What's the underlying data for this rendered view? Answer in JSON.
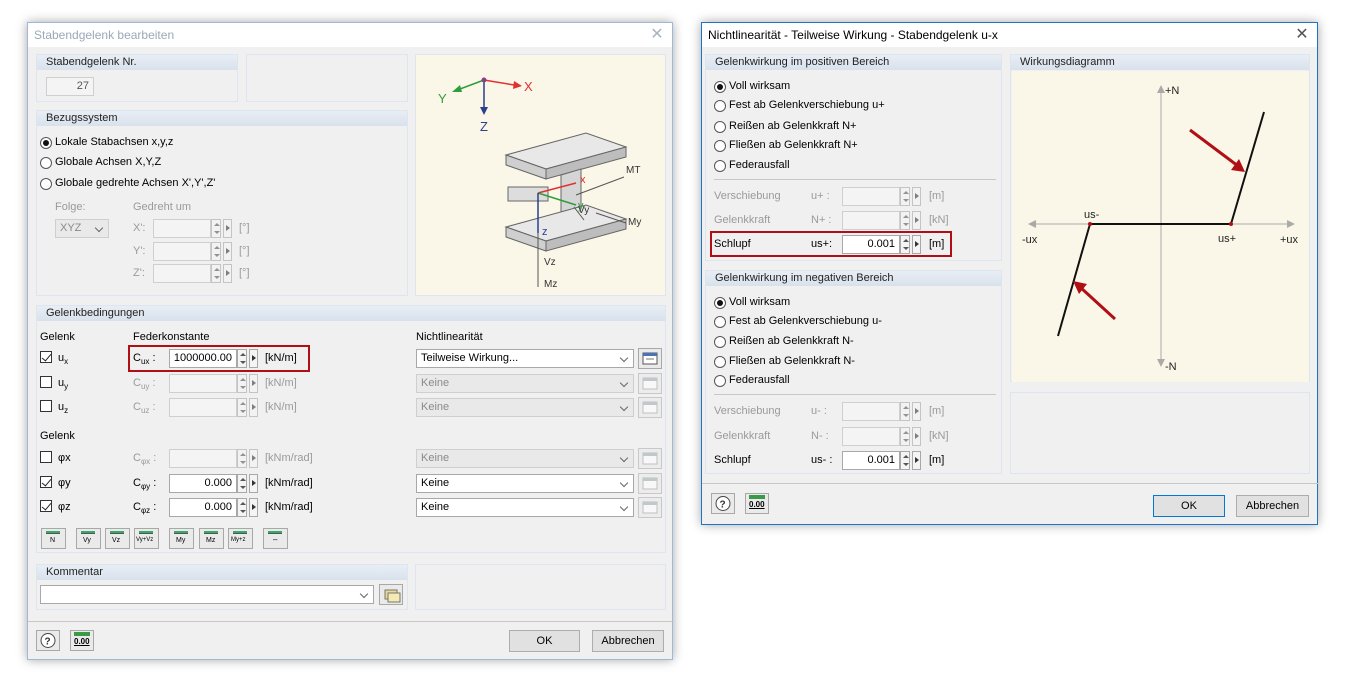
{
  "left_dialog": {
    "title": "Stabendgelenk bearbeiten",
    "nr_label": "Stabendgelenk Nr.",
    "nr_value": "27",
    "ref_label": "Bezugssystem",
    "ref_options": [
      "Lokale Stabachsen x,y,z",
      "Globale Achsen X,Y,Z",
      "Globale gedrehte Achsen X',Y',Z'"
    ],
    "folge_label": "Folge:",
    "folge_value": "XYZ",
    "gedreht_label": "Gedreht um",
    "rot_axes": [
      "X':",
      "Y':",
      "Z':"
    ],
    "deg_unit": "[°]",
    "cond_label": "Gelenkbedingungen",
    "gelenk_label": "Gelenk",
    "feder_label": "Federkonstante",
    "nonlin_label": "Nichtlinearität",
    "translations": [
      {
        "name": "ux",
        "sub": "x",
        "checked": true,
        "const_main": "C",
        "const_sub": "ux",
        "value": "1000000.00",
        "unit": "[kN/m]",
        "nonlin": "Teilweise Wirkung...",
        "enabled": true
      },
      {
        "name": "uy",
        "sub": "y",
        "checked": false,
        "const_main": "C",
        "const_sub": "uy",
        "value": "",
        "unit": "[kN/m]",
        "nonlin": "Keine",
        "enabled": false
      },
      {
        "name": "uz",
        "sub": "z",
        "checked": false,
        "const_main": "C",
        "const_sub": "uz",
        "value": "",
        "unit": "[kN/m]",
        "nonlin": "Keine",
        "enabled": false
      }
    ],
    "rotations": [
      {
        "name": "φx",
        "checked": false,
        "const_main": "C",
        "const_sub": "φx",
        "value": "",
        "unit": "[kNm/rad]",
        "nonlin": "Keine",
        "enabled": false
      },
      {
        "name": "φy",
        "checked": true,
        "const_main": "C",
        "const_sub": "φy",
        "value": "0.000",
        "unit": "[kNm/rad]",
        "nonlin": "Keine",
        "enabled": true
      },
      {
        "name": "φz",
        "checked": true,
        "const_main": "C",
        "const_sub": "φz",
        "value": "0.000",
        "unit": "[kNm/rad]",
        "nonlin": "Keine",
        "enabled": true
      }
    ],
    "preset_buttons": [
      "N",
      "Vy",
      "Vz",
      "Vy+Vz",
      "My",
      "Mz",
      "My+z",
      "–"
    ],
    "comment_label": "Kommentar",
    "ok_label": "OK",
    "cancel_label": "Abbrechen",
    "calc_label": "0.00",
    "graphic_labels": {
      "x": "X",
      "y": "Y",
      "z": "Z",
      "lx": "x",
      "ly": "y",
      "lz": "z",
      "mt": "MT",
      "my": "My",
      "vy": "Vy",
      "vz": "Vz",
      "mz": "Mz"
    }
  },
  "right_dialog": {
    "title": "Nichtlinearität - Teilweise Wirkung - Stabendgelenk u-x",
    "pos_group": "Gelenkwirkung im positiven Bereich",
    "pos_options": [
      "Voll wirksam",
      "Fest ab Gelenkverschiebung u+",
      "Reißen ab Gelenkkraft N+",
      "Fließen ab Gelenkkraft N+",
      "Federausfall"
    ],
    "pos_fields": [
      {
        "label": "Verschiebung",
        "sym": "u+ :",
        "value": "",
        "unit": "[m]",
        "enabled": false
      },
      {
        "label": "Gelenkkraft",
        "sym": "N+ :",
        "value": "",
        "unit": "[kN]",
        "enabled": false
      },
      {
        "label": "Schlupf",
        "sym": "us+:",
        "value": "0.001",
        "unit": "[m]",
        "enabled": true
      }
    ],
    "neg_group": "Gelenkwirkung im negativen Bereich",
    "neg_options": [
      "Voll wirksam",
      "Fest ab Gelenkverschiebung u-",
      "Reißen ab Gelenkkraft N-",
      "Fließen ab Gelenkkraft N-",
      "Federausfall"
    ],
    "neg_fields": [
      {
        "label": "Verschiebung",
        "sym": "u- :",
        "value": "",
        "unit": "[m]",
        "enabled": false
      },
      {
        "label": "Gelenkkraft",
        "sym": "N- :",
        "value": "",
        "unit": "[kN]",
        "enabled": false
      },
      {
        "label": "Schlupf",
        "sym": "us- :",
        "value": "0.001",
        "unit": "[m]",
        "enabled": true
      }
    ],
    "diagram_label": "Wirkungsdiagramm",
    "diagram_text": {
      "pn": "+N",
      "nn": "-N",
      "pu": "+ux",
      "nu": "-ux",
      "usp": "us+",
      "usm": "us-"
    },
    "ok_label": "OK",
    "cancel_label": "Abbrechen",
    "calc_label": "0.00"
  },
  "colors": {
    "accent_red": "#b01015",
    "axis_green": "#2e9e3c",
    "axis_red": "#e23030",
    "axis_blue": "#2c3f8f"
  }
}
